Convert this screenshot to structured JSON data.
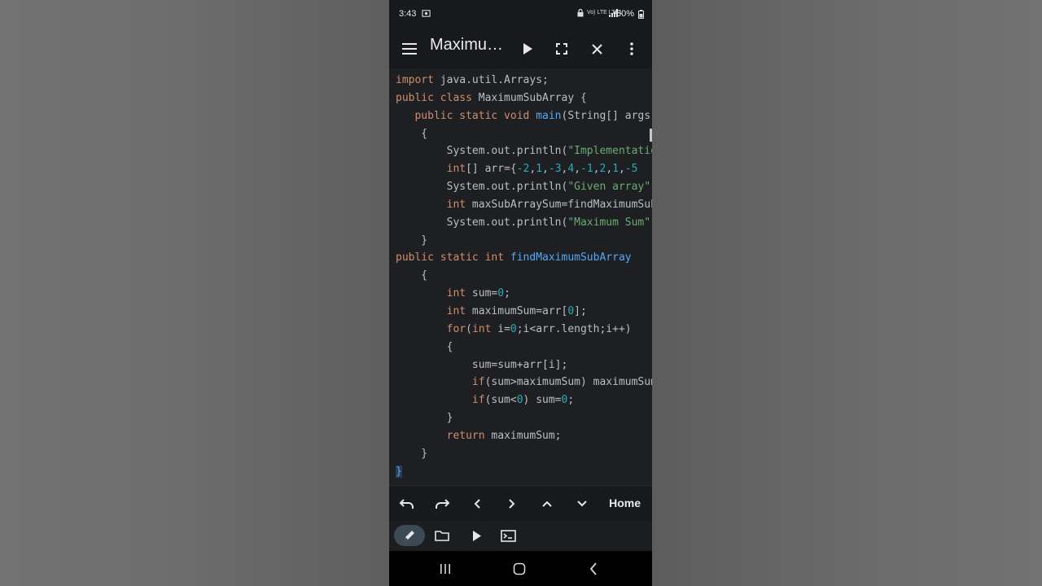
{
  "status": {
    "time": "3:43",
    "network_icons": "Vo) LTE LTE1",
    "battery": "60%"
  },
  "appbar": {
    "title": "Maximum..."
  },
  "editor": {
    "lines": [
      [
        {
          "t": "import",
          "c": "kw"
        },
        {
          "t": " java.util.Arrays;"
        }
      ],
      [
        {
          "t": "public class",
          "c": "kw"
        },
        {
          "t": " MaximumSubArray "
        },
        {
          "t": "{",
          "c": "br"
        }
      ],
      [
        {
          "t": "   "
        },
        {
          "t": "public static void",
          "c": "kw"
        },
        {
          "t": " "
        },
        {
          "t": "main",
          "c": "fn"
        },
        {
          "t": "(String[] args)"
        }
      ],
      [
        {
          "t": "    {"
        }
      ],
      [
        {
          "t": "        System.out.println("
        },
        {
          "t": "\"Implementation\"",
          "c": "str"
        }
      ],
      [
        {
          "t": "        "
        },
        {
          "t": "int",
          "c": "kw"
        },
        {
          "t": "[] arr={"
        },
        {
          "t": "-2",
          "c": "num"
        },
        {
          "t": ","
        },
        {
          "t": "1",
          "c": "num"
        },
        {
          "t": ","
        },
        {
          "t": "-3",
          "c": "num"
        },
        {
          "t": ","
        },
        {
          "t": "4",
          "c": "num"
        },
        {
          "t": ","
        },
        {
          "t": "-1",
          "c": "num"
        },
        {
          "t": ","
        },
        {
          "t": "2",
          "c": "num"
        },
        {
          "t": ","
        },
        {
          "t": "1",
          "c": "num"
        },
        {
          "t": ","
        },
        {
          "t": "-5",
          "c": "num"
        }
      ],
      [
        {
          "t": "        System.out.println("
        },
        {
          "t": "\"Given array\"",
          "c": "str"
        }
      ],
      [
        {
          "t": "        "
        },
        {
          "t": "int",
          "c": "kw"
        },
        {
          "t": " maxSubArraySum=findMaximumSubArray"
        }
      ],
      [
        {
          "t": "        System.out.println("
        },
        {
          "t": "\"Maximum Sum\"",
          "c": "str"
        }
      ],
      [
        {
          "t": "    }"
        }
      ],
      [
        {
          "t": "public static int",
          "c": "kw"
        },
        {
          "t": " "
        },
        {
          "t": "findMaximumSubArray",
          "c": "fn"
        }
      ],
      [
        {
          "t": "    {"
        }
      ],
      [
        {
          "t": "        "
        },
        {
          "t": "int",
          "c": "kw"
        },
        {
          "t": " sum="
        },
        {
          "t": "0",
          "c": "num"
        },
        {
          "t": ";"
        }
      ],
      [
        {
          "t": "        "
        },
        {
          "t": "int",
          "c": "kw"
        },
        {
          "t": " maximumSum=arr["
        },
        {
          "t": "0",
          "c": "num"
        },
        {
          "t": "];"
        }
      ],
      [
        {
          "t": "        "
        },
        {
          "t": "for",
          "c": "kw"
        },
        {
          "t": "("
        },
        {
          "t": "int",
          "c": "kw"
        },
        {
          "t": " i="
        },
        {
          "t": "0",
          "c": "num"
        },
        {
          "t": ";i<arr.length;i++)"
        }
      ],
      [
        {
          "t": "        {"
        }
      ],
      [
        {
          "t": "            sum=sum+arr[i];"
        }
      ],
      [
        {
          "t": "            "
        },
        {
          "t": "if",
          "c": "kw"
        },
        {
          "t": "(sum>maximumSum) maximumSum=sum;"
        }
      ],
      [
        {
          "t": "            "
        },
        {
          "t": "if",
          "c": "kw"
        },
        {
          "t": "(sum<"
        },
        {
          "t": "0",
          "c": "num"
        },
        {
          "t": ") sum="
        },
        {
          "t": "0",
          "c": "num"
        },
        {
          "t": ";"
        }
      ],
      [
        {
          "t": "        }"
        }
      ],
      [
        {
          "t": "        "
        },
        {
          "t": "return",
          "c": "kw"
        },
        {
          "t": " maximumSum;"
        }
      ],
      [
        {
          "t": "    }"
        }
      ],
      [
        {
          "t": "}",
          "c": "br-hl"
        }
      ]
    ]
  },
  "keybar": {
    "home_label": "Home"
  },
  "icons": {
    "menu": "menu-icon",
    "run": "play-icon",
    "fullscreen": "fullscreen-icon",
    "close": "close-icon",
    "more": "more-vert-icon",
    "undo": "undo-icon",
    "redo": "redo-icon",
    "left": "chevron-left-icon",
    "right": "chevron-right-icon",
    "up": "chevron-up-icon",
    "down": "chevron-down-icon",
    "edit": "pencil-icon",
    "folder": "folder-icon",
    "terminal": "terminal-icon"
  },
  "colors": {
    "keyword": "#cf8e6d",
    "function": "#56a8f5",
    "number": "#2aacb8",
    "string": "#6aab73",
    "editor_bg": "#1e1f22"
  }
}
